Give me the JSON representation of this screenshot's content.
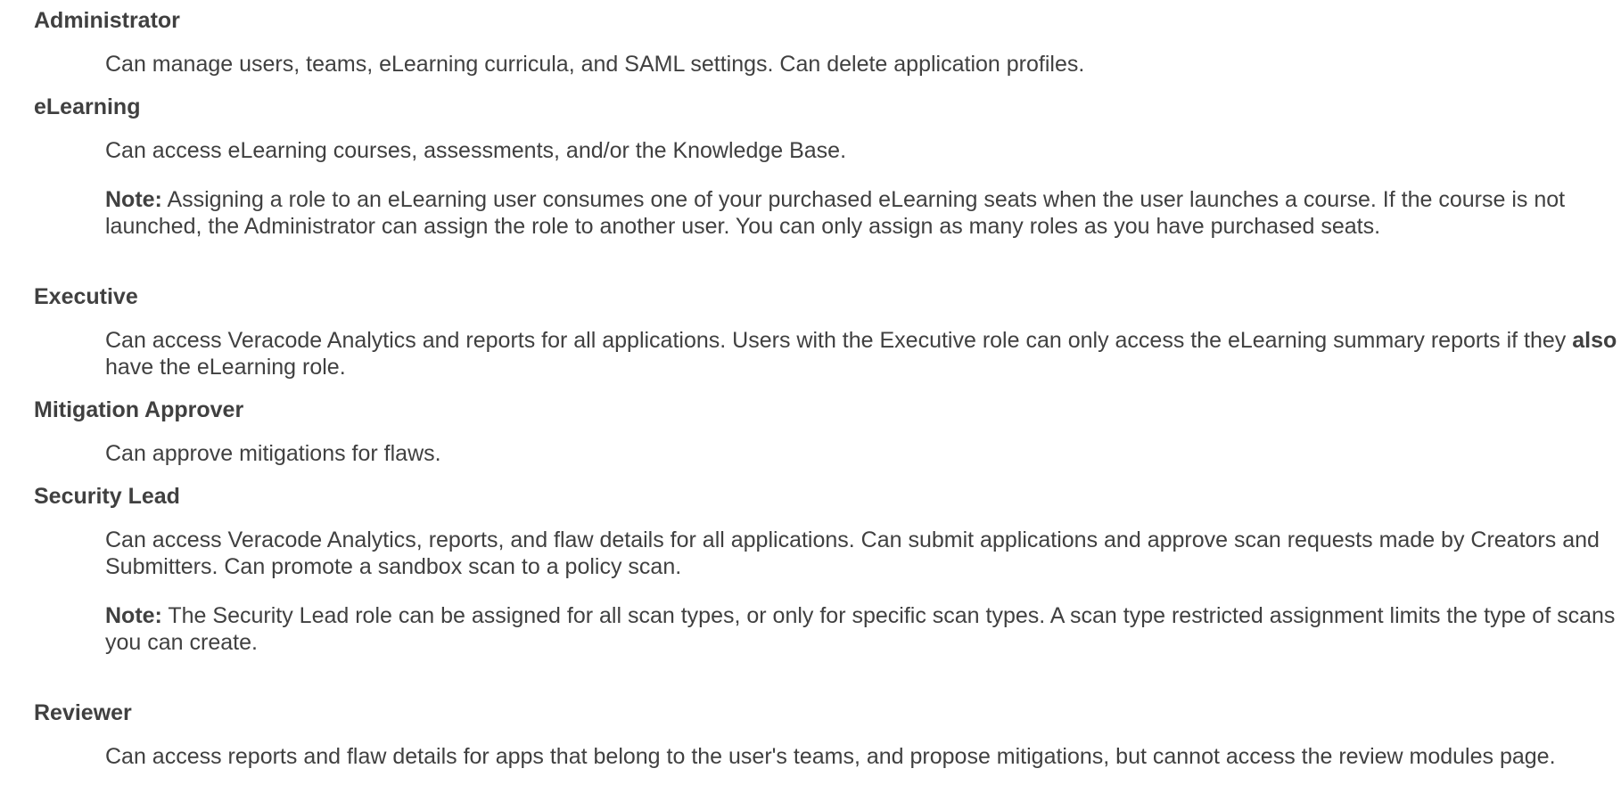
{
  "roles": [
    {
      "name": "Administrator",
      "description": "Can manage users, teams, eLearning curricula, and SAML settings. Can delete application profiles."
    },
    {
      "name": "eLearning",
      "description": "Can access eLearning courses, assessments, and/or the Knowledge Base.",
      "note_label": "Note:",
      "note_text": " Assigning a role to an eLearning user consumes one of your purchased eLearning seats when the user launches a course. If the course is not launched, the Administrator can assign the role to another user. You can only assign as many roles as you have purchased seats."
    },
    {
      "name": "Executive",
      "description_part1": "Can access Veracode Analytics and reports for all applications. Users with the Executive role can only access the eLearning summary reports if they ",
      "description_bold": "also",
      "description_part2": " have the eLearning role."
    },
    {
      "name": "Mitigation Approver",
      "description": "Can approve mitigations for flaws."
    },
    {
      "name": "Security Lead",
      "description": "Can access Veracode Analytics, reports, and flaw details for all applications. Can submit applications and approve scan requests made by Creators and Submitters. Can promote a sandbox scan to a policy scan.",
      "note_label": "Note:",
      "note_text": " The Security Lead role can be assigned for all scan types, or only for specific scan types. A scan type restricted assignment limits the type of scans you can create."
    },
    {
      "name": "Reviewer",
      "description": "Can access reports and flaw details for apps that belong to the user's teams, and propose mitigations, but cannot access the review modules page."
    }
  ]
}
